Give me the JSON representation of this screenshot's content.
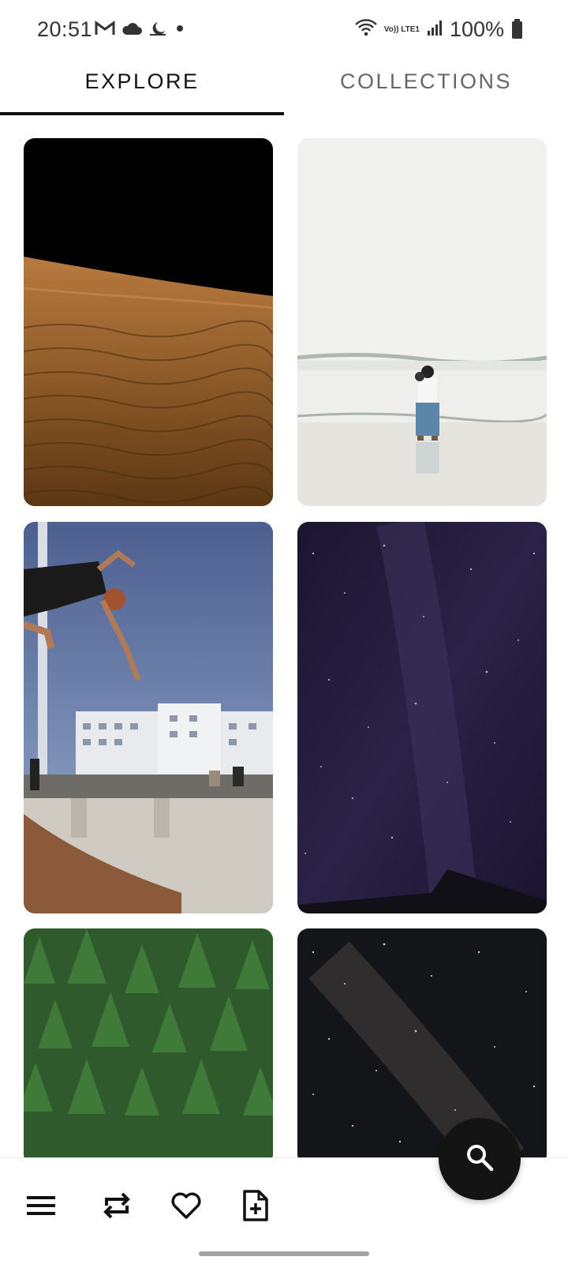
{
  "status_bar": {
    "time": "20:51",
    "battery": "100%",
    "network": "Vo)) LTE1",
    "icons_left": [
      "gmail-icon",
      "cloud-icon",
      "night-mode-icon",
      "dot-icon"
    ],
    "icons_right": [
      "wifi-icon",
      "lte-icon",
      "signal-icon",
      "battery-icon"
    ]
  },
  "tabs": [
    {
      "label": "EXPLORE",
      "active": true
    },
    {
      "label": "COLLECTIONS",
      "active": false
    }
  ],
  "photos": [
    {
      "subject": "desert-dunes-photo"
    },
    {
      "subject": "beach-parent-child-photo"
    },
    {
      "subject": "skatepark-jump-photo"
    },
    {
      "subject": "night-sky-stars-photo"
    },
    {
      "subject": "green-forest-photo"
    },
    {
      "subject": "milky-way-photo"
    }
  ],
  "bottom_bar": {
    "items": [
      "menu-icon",
      "repeat-icon",
      "heart-icon",
      "add-file-icon"
    ]
  },
  "fab": {
    "icon": "search-icon"
  },
  "colors": {
    "accent": "#141414",
    "tab_active": "#111111",
    "tab_inactive": "#666666"
  }
}
